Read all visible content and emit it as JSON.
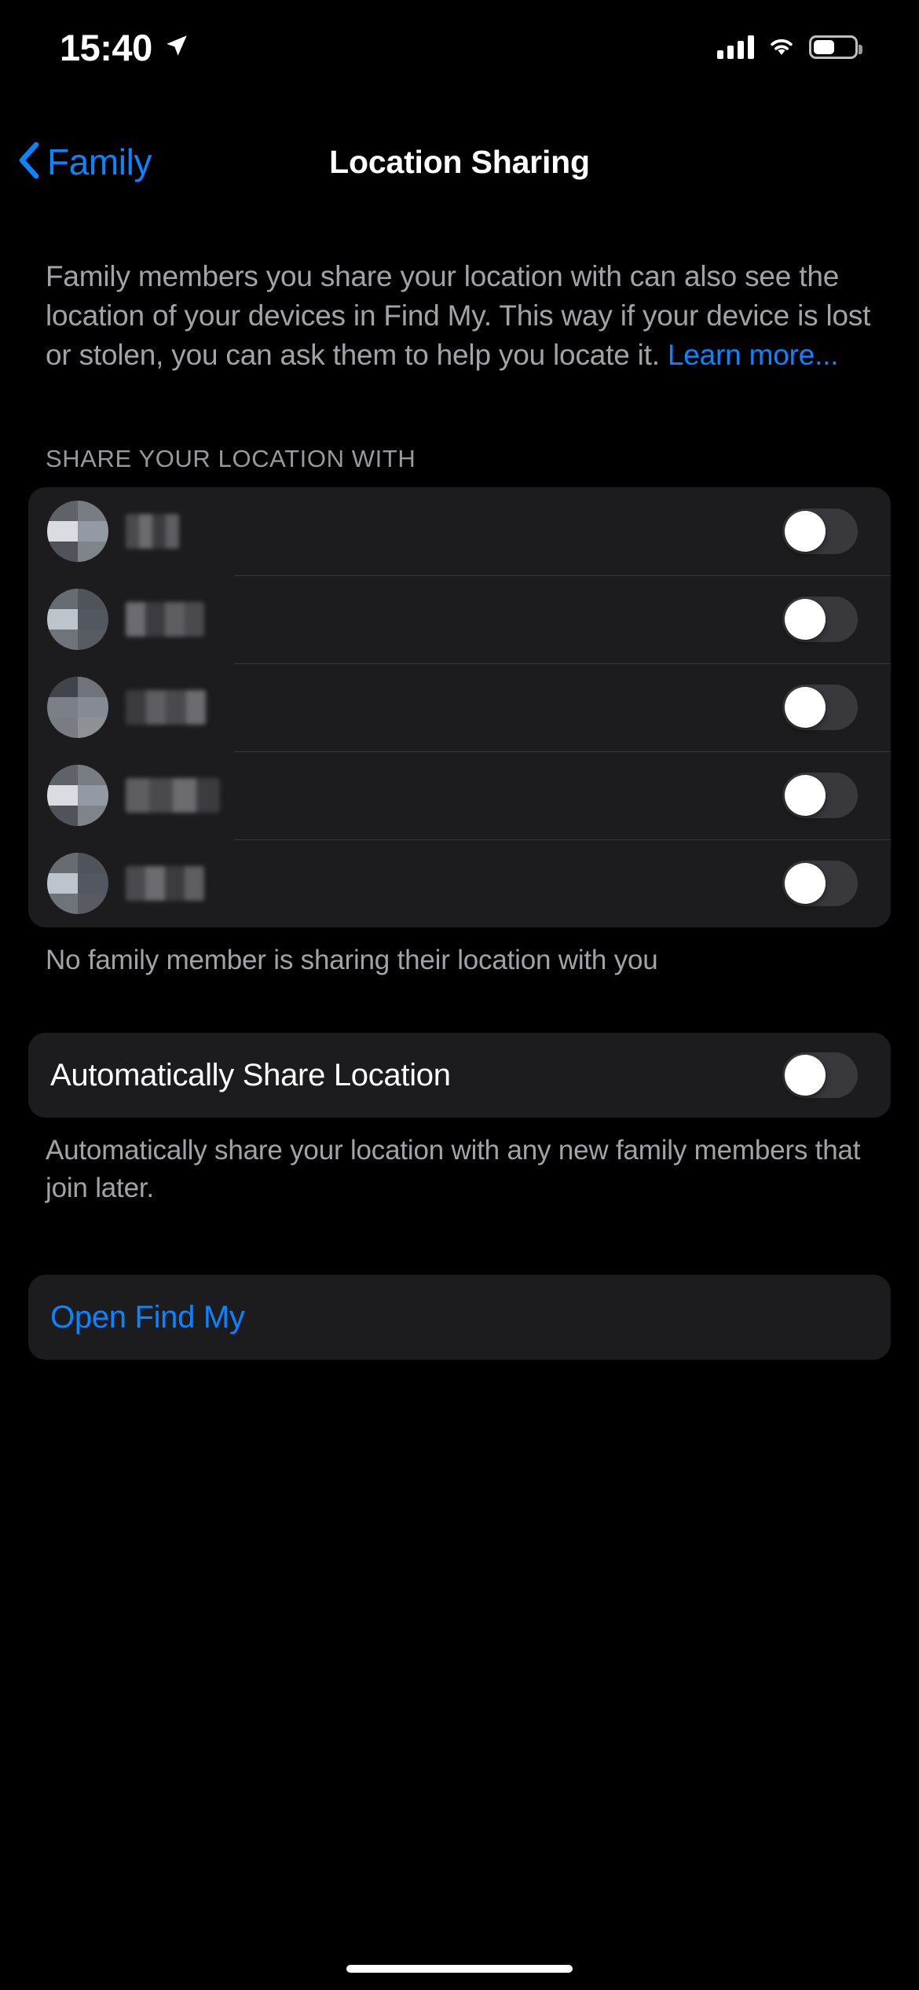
{
  "status_bar": {
    "time": "15:40",
    "location_icon": "location-arrow-icon",
    "signal_icon": "cellular-signal-icon",
    "signal_bars": 4,
    "wifi_icon": "wifi-icon",
    "battery_icon": "battery-icon",
    "battery_percent": 52
  },
  "nav": {
    "back_icon": "chevron-left-icon",
    "back_label": "Family",
    "title": "Location Sharing"
  },
  "intro": {
    "text": "Family members you share your location with can also see the location of your devices in Find My. This way if your device is lost or stolen, you can ask them to help you locate it. ",
    "link_label": "Learn more..."
  },
  "share_section": {
    "header": "SHARE YOUR LOCATION WITH",
    "members": [
      {
        "name": "",
        "redacted": true,
        "avatar": "redacted-avatar",
        "toggle_on": false,
        "name_width": 68
      },
      {
        "name": "",
        "redacted": true,
        "avatar": "redacted-avatar",
        "toggle_on": false,
        "name_width": 100
      },
      {
        "name": "",
        "redacted": true,
        "avatar": "redacted-avatar",
        "toggle_on": false,
        "name_width": 102
      },
      {
        "name": "",
        "redacted": true,
        "avatar": "redacted-avatar",
        "toggle_on": false,
        "name_width": 120
      },
      {
        "name": "",
        "redacted": true,
        "avatar": "redacted-avatar",
        "toggle_on": false,
        "name_width": 100
      }
    ],
    "footer": "No family member is sharing their location with you"
  },
  "auto_share": {
    "label": "Automatically Share Location",
    "toggle_on": false,
    "footer": "Automatically share your location with any new family members that join later."
  },
  "find_my": {
    "label": "Open Find My"
  },
  "colors": {
    "accent_blue": "#0a84ff",
    "background": "#000000",
    "card": "#1c1c1e",
    "secondary_text": "#a2a2a8",
    "toggle_off_track": "#39393d",
    "toggle_knob": "#ffffff",
    "separator": "#38383a"
  },
  "home_indicator": "home-indicator"
}
